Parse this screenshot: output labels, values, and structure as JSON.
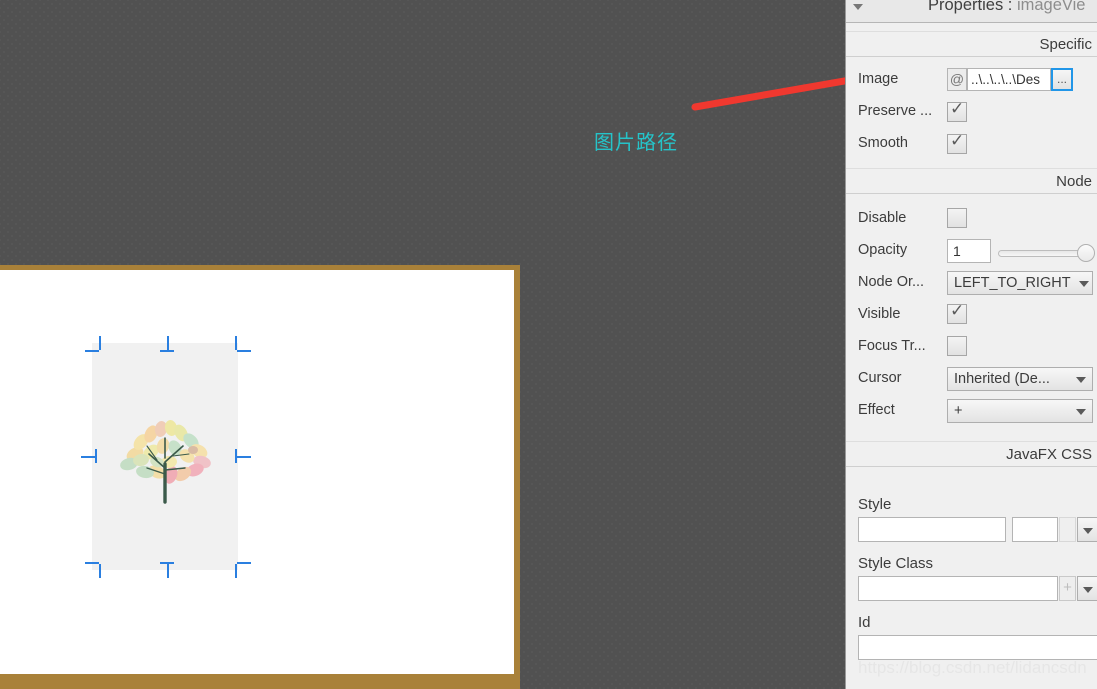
{
  "annotation": {
    "text": "图片路径",
    "color": "#25c3c9",
    "arrow_color": "#f0382f"
  },
  "scene": {
    "background_color": "#515151",
    "canvas_frame_color": "#a98139",
    "canvas_color": "#ffffff",
    "selected_node_name": "imageView",
    "selection_handle_color": "#2a7fe0"
  },
  "panel": {
    "twisty_icon": "chevron-down-icon",
    "title_prefix": "Properties : ",
    "title_target": "imageVie",
    "sections": {
      "specific": {
        "header": "Specific",
        "rows": [
          {
            "label": "Image",
            "type": "path",
            "at_symbol": "@",
            "value": "..\\..\\..\\..\\Des",
            "browse_label": "..."
          },
          {
            "label": "Preserve ...",
            "type": "checkbox",
            "checked": true
          },
          {
            "label": "Smooth",
            "type": "checkbox",
            "checked": true
          }
        ]
      },
      "node": {
        "header": "Node",
        "rows": [
          {
            "label": "Disable",
            "type": "checkbox",
            "checked": false
          },
          {
            "label": "Opacity",
            "type": "number-slider",
            "value": "1",
            "slider_value": 100
          },
          {
            "label": "Node Or...",
            "type": "combo",
            "value": "LEFT_TO_RIGHT"
          },
          {
            "label": "Visible",
            "type": "checkbox",
            "checked": true
          },
          {
            "label": "Focus Tr...",
            "type": "checkbox",
            "checked": false
          },
          {
            "label": "Cursor",
            "type": "combo",
            "value": "Inherited (De..."
          },
          {
            "label": "Effect",
            "type": "combo",
            "value": "+"
          }
        ]
      },
      "javafx_css": {
        "header": "JavaFX CSS",
        "style": {
          "label": "Style",
          "value": "",
          "second_value": "",
          "dropdown_icon": "chevron-down-icon"
        },
        "style_class": {
          "label": "Style Class",
          "value": "",
          "add_label": "+",
          "dropdown_icon": "chevron-down-icon"
        },
        "id": {
          "label": "Id",
          "value": ""
        }
      }
    },
    "watermark": "https://blog.csdn.net/lidancsdn"
  }
}
